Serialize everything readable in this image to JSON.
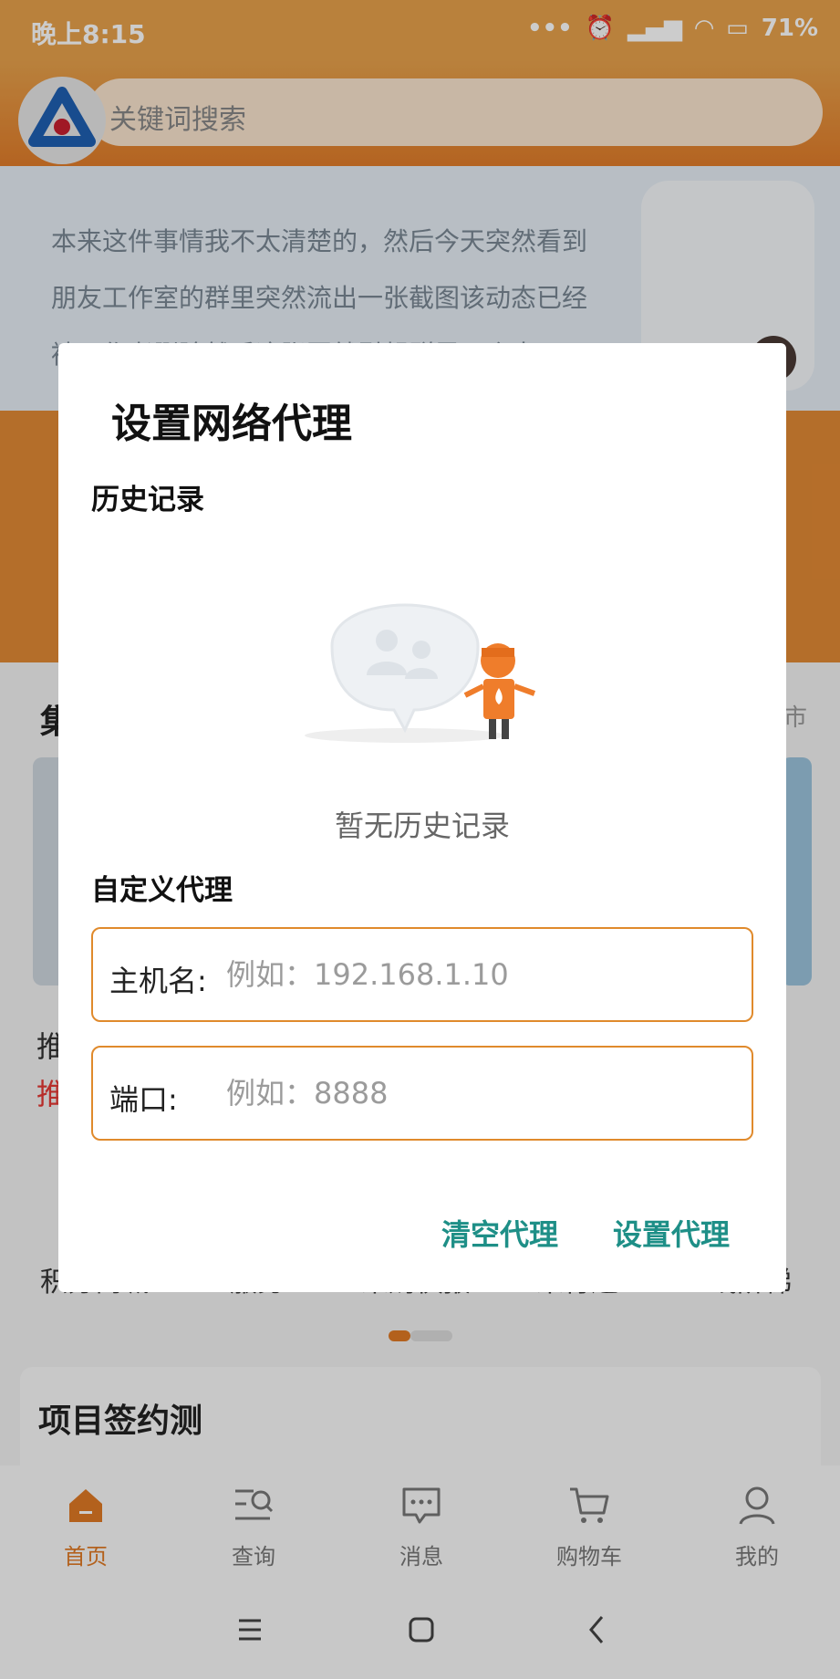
{
  "status_bar": {
    "time": "晚上8:15",
    "battery": "71"
  },
  "search": {
    "placeholder": "关键词搜索"
  },
  "banner": {
    "lines": [
      "本来这件事情我不太清楚的，然后今天突然看到",
      "朋友工作室的群里突然流出一张截图该动态已经",
      "被原作者删除然后这张图就引起群里几个大"
    ]
  },
  "section": {
    "title_partial": "集",
    "right_partial": "市",
    "frag1": "推",
    "frag2": "推"
  },
  "grid_labels": [
    "积分商城",
    "服务",
    "采购快报",
    "采行通",
    "上线阶梯"
  ],
  "sign_section": {
    "title": "项目签约测"
  },
  "tabs": [
    {
      "label": "首页",
      "icon": "home-icon"
    },
    {
      "label": "查询",
      "icon": "search-list-icon"
    },
    {
      "label": "消息",
      "icon": "message-icon"
    },
    {
      "label": "购物车",
      "icon": "cart-icon"
    },
    {
      "label": "我的",
      "icon": "user-icon"
    }
  ],
  "dialog": {
    "title": "设置网络代理",
    "history_label": "历史记录",
    "empty_text": "暂无历史记录",
    "custom_label": "自定义代理",
    "host": {
      "label": "主机名:",
      "placeholder": "例如：192.168.1.10",
      "value": ""
    },
    "port": {
      "label": "端口:",
      "placeholder": "例如：8888",
      "value": ""
    },
    "clear_button": "清空代理",
    "set_button": "设置代理"
  },
  "colors": {
    "accent": "#e07a25",
    "button_text": "#1e8f87",
    "field_border": "#e08a2c"
  }
}
